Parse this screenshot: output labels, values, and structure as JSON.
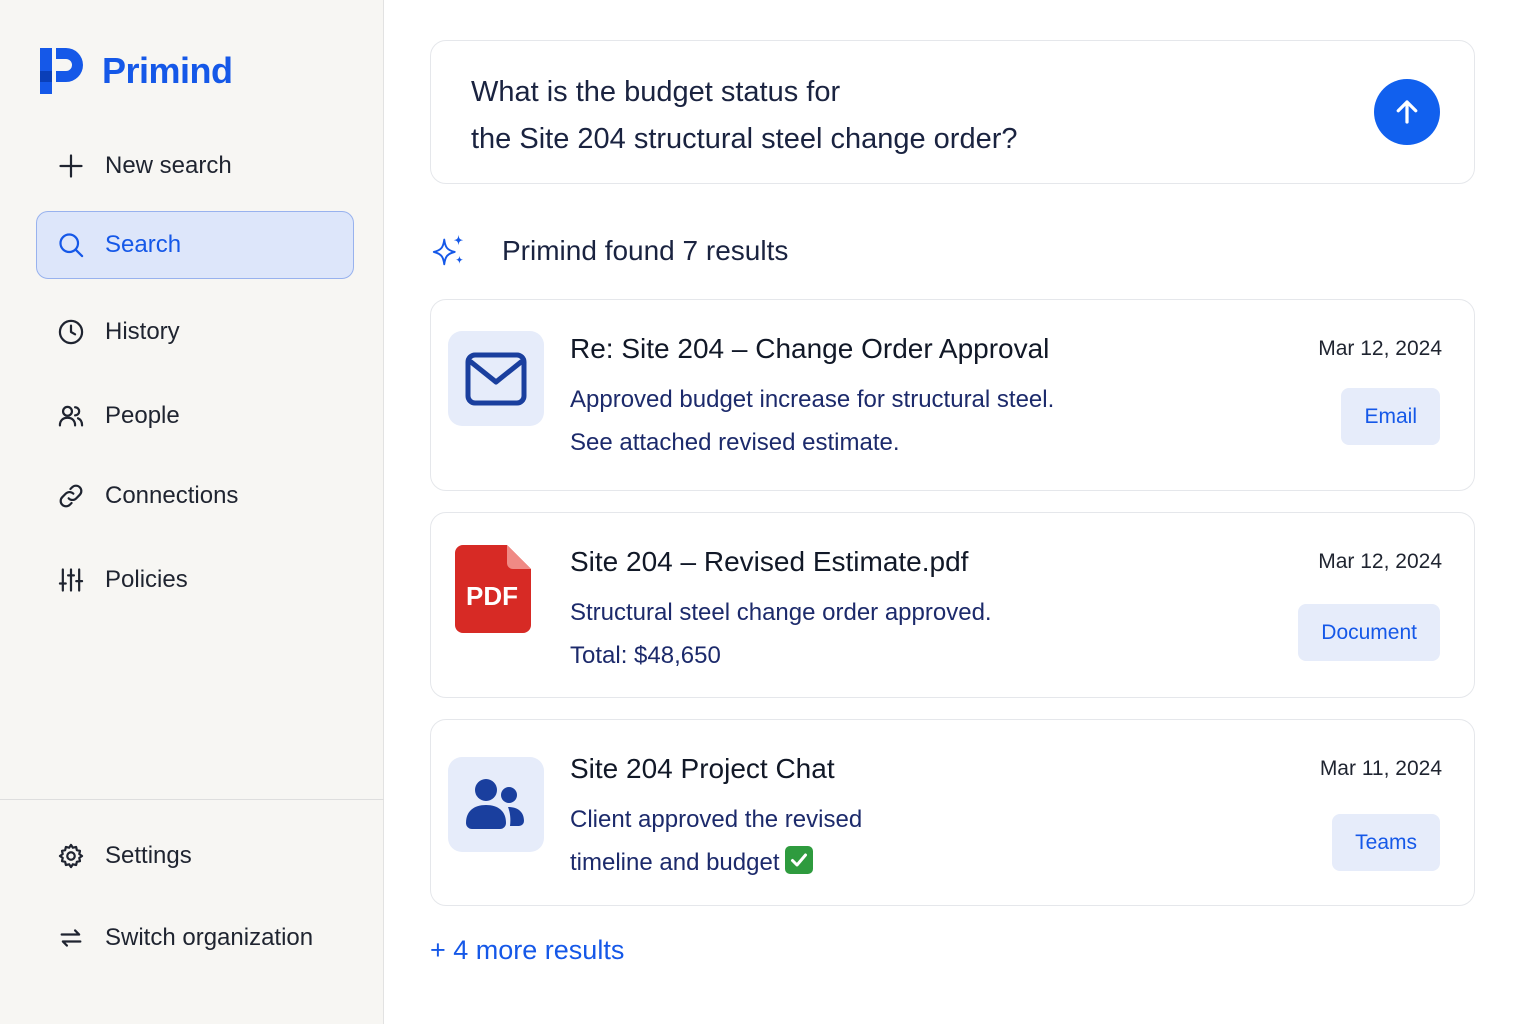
{
  "app": {
    "name": "Primind",
    "accent_color": "#1558e8"
  },
  "sidebar": {
    "items": [
      {
        "label": "New search",
        "icon": "plus-icon"
      },
      {
        "label": "Search",
        "icon": "search-icon",
        "active": true
      },
      {
        "label": "History",
        "icon": "clock-icon"
      },
      {
        "label": "People",
        "icon": "people-icon"
      },
      {
        "label": "Connections",
        "icon": "link-icon"
      },
      {
        "label": "Policies",
        "icon": "sliders-icon"
      }
    ],
    "bottom_items": [
      {
        "label": "Settings",
        "icon": "gear-icon"
      },
      {
        "label": "Switch organization",
        "icon": "swap-icon"
      }
    ]
  },
  "query": {
    "line1": "What is the budget status for",
    "line2": "the Site 204 structural steel change order?",
    "send_icon": "arrow-up-icon"
  },
  "results": {
    "summary": "Primind found 7 results",
    "items": [
      {
        "title": "Re: Site 204 – Change Order Approval",
        "snippet_line1": "Approved budget increase for structural steel.",
        "snippet_line2": "See attached revised estimate.",
        "date": "Mar 12, 2024",
        "type": "Email",
        "icon": "mail-icon"
      },
      {
        "title": "Site 204 – Revised Estimate.pdf",
        "snippet_line1": "Structural steel change order approved.",
        "snippet_line2": "Total: $48,650",
        "date": "Mar 12, 2024",
        "type": "Document",
        "icon": "pdf-icon",
        "icon_label": "PDF"
      },
      {
        "title": "Site 204 Project Chat",
        "snippet_line1": "Client approved the revised",
        "snippet_line2": "timeline and budget",
        "date": "Mar 11, 2024",
        "type": "Teams",
        "icon": "team-icon"
      }
    ],
    "more": "+ 4 more results"
  }
}
